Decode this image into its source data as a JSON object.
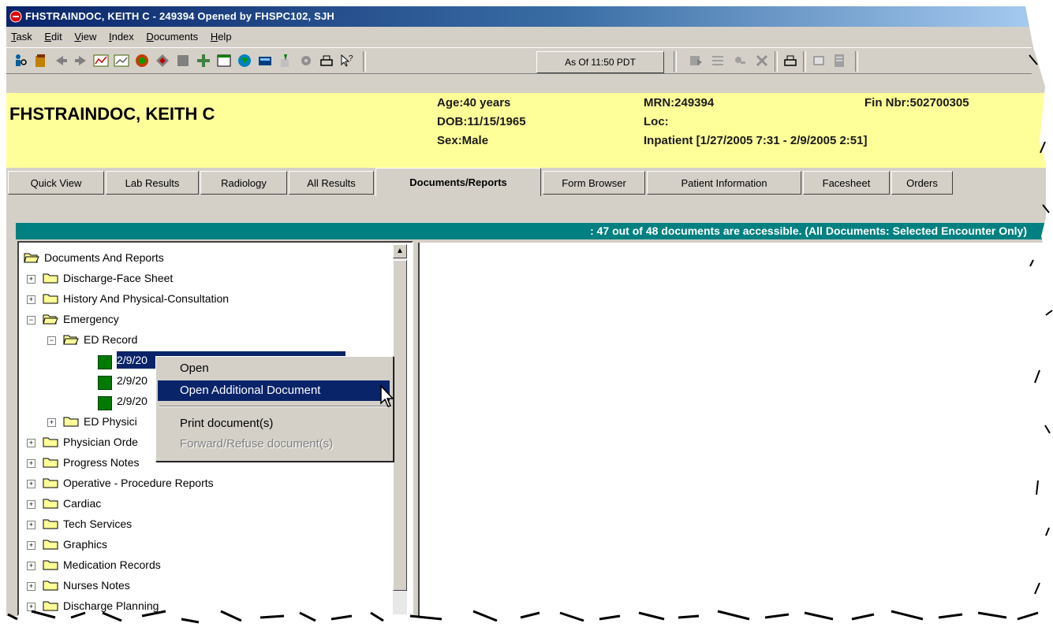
{
  "window": {
    "title": "FHSTRAINDOC, KEITH C - 249394 Opened by FHSPC102, SJH"
  },
  "menu": [
    {
      "u": "T",
      "rest": "ask"
    },
    {
      "u": "E",
      "rest": "dit"
    },
    {
      "u": "V",
      "rest": "iew"
    },
    {
      "u": "I",
      "rest": "ndex"
    },
    {
      "u": "D",
      "rest": "ocuments"
    },
    {
      "u": "H",
      "rest": "elp"
    }
  ],
  "toolbar": {
    "as_of_label": "As Of 11:50 PDT",
    "icons": [
      "patient-search-icon",
      "chart-icon",
      "back-arrow-icon",
      "forward-arrow-icon",
      "emergency-icon",
      "chart-graph-icon",
      "orders-icon",
      "diamond-icon",
      "stop-icon",
      "vitals-icon",
      "window-icon",
      "globe-icon",
      "calculator-icon",
      "pen-icon",
      "record-icon",
      "print-icon",
      "context-help-icon",
      "forward-icon",
      "list-icon",
      "find-icon",
      "delete-icon",
      "print-report-icon",
      "view-icon",
      "notes-icon"
    ]
  },
  "banner": {
    "name": "FHSTRAINDOC, KEITH C",
    "age": "Age:40 years",
    "dob": "DOB:11/15/1965",
    "sex": "Sex:Male",
    "mrn": "MRN:249394",
    "loc": "Loc:",
    "encounter": "Inpatient [1/27/2005 7:31 - 2/9/2005 2:51]",
    "fin": "Fin Nbr:502700305"
  },
  "tabs": [
    "Quick View",
    "Lab Results",
    "Radiology",
    "All Results",
    "Documents/Reports",
    "Form Browser",
    "Patient Information",
    "Facesheet",
    "Orders"
  ],
  "active_tab": "Documents/Reports",
  "status": ": 47 out of 48 documents are accessible. (All Documents: Selected Encounter Only)",
  "tree": {
    "root": "Documents And Reports",
    "items": [
      "Discharge-Face Sheet",
      "History And Physical-Consultation",
      "Emergency",
      "ED Record",
      "2/9/20",
      "2/9/20",
      "2/9/20",
      "ED Physici",
      "Physician Orde",
      "Progress Notes",
      "Operative - Procedure Reports",
      "Cardiac",
      "Tech Services",
      "Graphics",
      "Medication Records",
      "Nurses Notes",
      "Discharge Planning"
    ]
  },
  "context_menu": {
    "open": "Open",
    "open_additional": "Open Additional Document",
    "print": "Print document(s)",
    "forward_refuse": "Forward/Refuse document(s)"
  },
  "colors": {
    "banner": "#ffff99",
    "status_bar": "#008080",
    "selection": "#0a246a",
    "doc_icon": "#007a00"
  }
}
